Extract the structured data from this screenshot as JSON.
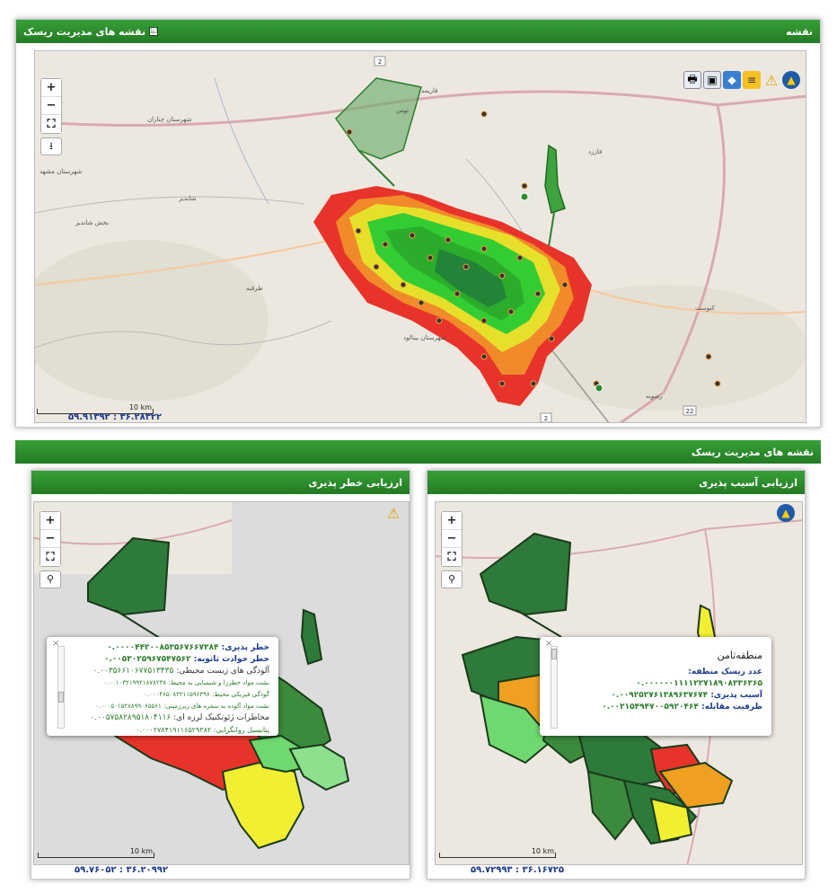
{
  "top_panel": {
    "title_right": "نقشه",
    "title_left": "نقشه های مدیریت ریسک",
    "checkbox": "☑",
    "coords": "۵۹.۹۱۳۹۲ : ۳۶.۲۸۳۲۲",
    "scale_label": "10 km",
    "labels": [
      "توس",
      "فاریمد",
      "فاززد",
      "شاندیز",
      "طرقبه",
      "کنوست",
      "رضویه",
      "شهرستان بینالود",
      "بخش شاندیز",
      "شهرستان مشهد",
      "شهرستان چناران"
    ],
    "road_labels": [
      "2",
      "22",
      "2"
    ]
  },
  "middle_bar": {
    "title": "نقشه های مدیریت ریسک"
  },
  "left_panel": {
    "title": "ارزیابی خطر پذیری",
    "coords": "۵۹.۷۶۰۵۲ : ۳۶.۲۰۹۹۲",
    "scale_label": "10 km",
    "popup_rows": [
      {
        "label": "خطر پذیری:",
        "value": "۰.۰۰۰۰۴۴۲۰۰۸۵۳۵۶۷۶۶۷۳۸۴"
      },
      {
        "label": "خطر حوادث ثانویه:",
        "value": "۰.۰۰۵۳۰۲۵۹۶۷۵۴۷۵۶۲"
      },
      {
        "label": "آلودگی های زیست محیطی:",
        "value": "۰.۰۰۳۵۶۶۱۰۶۷۷۵۱۳۴۳۵"
      },
      {
        "label": "نشت مواد خطرزا و شیمیایی به محیط:",
        "value": "۰.۰۰۱۰۳۲۱۹۹۲۱۸۷۸۲۳۸"
      },
      {
        "label": "گودگی فیزیکی محیط:",
        "value": "۰.۰۰۰۴۶۵۰۸۳۲۱۱۵۹۶۳۹۶"
      },
      {
        "label": "نشت مواد آلوده به سفره های زیرزمینی:",
        "value": "۰.۰۰۰۵۰۱۵۲۸۸۹۹۰۶۵۵۶۱"
      },
      {
        "label": "مخاطرات ژئوتکنیک لرزه ای:",
        "value": "۰.۰۰۵۷۵۸۲۸۹۵۱۸۰۴۱۱۶"
      },
      {
        "label": "پتانسیل روانگرایی:",
        "value": "۰.۰۰۰۲۷۸۴۱۹۱۱۶۵۲۹۳۸۲"
      }
    ]
  },
  "right_panel": {
    "title": "ارزیابی آسیب پذیری",
    "coords": "۵۹.۷۲۹۹۳ : ۳۶.۱۶۷۲۵",
    "scale_label": "10 km",
    "popup_title": "منطقه‌ثامن",
    "popup_rows": [
      {
        "label": "عدد ریسک منطقه:",
        "value": ""
      },
      {
        "label": "",
        "value": "۰.۰۰۰۰۰۰۱۱۱۱۲۲۷۱۸۹۰۸۳۳۶۳۶۵"
      },
      {
        "label": "آسیب پذیری:",
        "value": "۰.۰۰۹۲۵۲۷۶۱۳۸۹۶۳۷۶۷۴"
      },
      {
        "label": "ظرفیت مقابله:",
        "value": "۰.۰۰۲۱۵۴۹۴۷۰۰۵۹۲۰۴۶۴"
      }
    ]
  },
  "icons": {
    "zoom_in": "+",
    "zoom_out": "−",
    "fullscreen": "⛶",
    "download": "⭳",
    "marker": "⚲",
    "close": "×"
  }
}
